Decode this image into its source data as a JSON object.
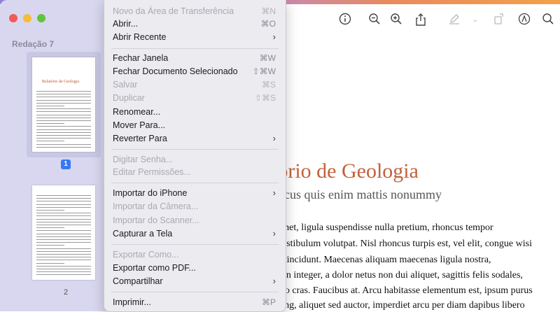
{
  "sidebar": {
    "title": "Redação 7",
    "page1_badge": "1",
    "page2_label": "2",
    "thumb1_title": "Relatório de Geologia"
  },
  "toolbar": {
    "icons": [
      "info-icon",
      "zoom-out-icon",
      "zoom-in-icon",
      "share-icon",
      "pencil-icon",
      "chevron-down-icon",
      "rotate-icon",
      "markup-icon",
      "search-icon"
    ]
  },
  "document": {
    "title": "Relatório de Geologia",
    "title_visible": "tório de Geologia",
    "subtitle_visible": "acus quis enim mattis nonummy",
    "lines": [
      "amet, ligula suspendisse nulla pretium, rhoncus tempor",
      "vestibulum volutpat. Nisl rhoncus turpis est, vel elit, congue wisi",
      "a tincidunt. Maecenas aliquam maecenas ligula nostra,",
      "s in integer, a dolor netus non dui aliquet, sagittis felis sodales,",
      "ero cras. Faucibus at. Arcu habitasse elementum est, ipsum purus",
      "cing, aliquet sed auctor, imperdiet arcu per diam dapibus libero"
    ]
  },
  "menu": {
    "items": [
      {
        "label": "Novo da Área de Transferência",
        "shortcut": "⌘N",
        "enabled": false
      },
      {
        "label": "Abrir...",
        "shortcut": "⌘O",
        "enabled": true
      },
      {
        "label": "Abrir Recente",
        "shortcut": "",
        "enabled": true,
        "submenu": true
      },
      {
        "label": "Fechar Janela",
        "shortcut": "⌘W",
        "enabled": true
      },
      {
        "label": "Fechar Documento Selecionado",
        "shortcut": "⇧⌘W",
        "enabled": true
      },
      {
        "label": "Salvar",
        "shortcut": "⌘S",
        "enabled": false
      },
      {
        "label": "Duplicar",
        "shortcut": "⇧⌘S",
        "enabled": false
      },
      {
        "label": "Renomear...",
        "shortcut": "",
        "enabled": true
      },
      {
        "label": "Mover Para...",
        "shortcut": "",
        "enabled": true
      },
      {
        "label": "Reverter Para",
        "shortcut": "",
        "enabled": true,
        "submenu": true
      },
      {
        "label": "Digitar Senha...",
        "shortcut": "",
        "enabled": false
      },
      {
        "label": "Editar Permissões...",
        "shortcut": "",
        "enabled": false
      },
      {
        "label": "Importar do iPhone",
        "shortcut": "",
        "enabled": true,
        "submenu": true
      },
      {
        "label": "Importar da Câmera...",
        "shortcut": "",
        "enabled": false
      },
      {
        "label": "Importar do Scanner...",
        "shortcut": "",
        "enabled": false
      },
      {
        "label": "Capturar a Tela",
        "shortcut": "",
        "enabled": true,
        "submenu": true
      },
      {
        "label": "Exportar Como...",
        "shortcut": "",
        "enabled": false
      },
      {
        "label": "Exportar como PDF...",
        "shortcut": "",
        "enabled": true
      },
      {
        "label": "Compartilhar",
        "shortcut": "",
        "enabled": true,
        "submenu": true
      },
      {
        "label": "Imprimir...",
        "shortcut": "⌘P",
        "enabled": true
      }
    ]
  },
  "colors": {
    "accent": "#3478f6",
    "title_orange": "#c2613b",
    "sidebar_bg": "#d8d7ef"
  }
}
